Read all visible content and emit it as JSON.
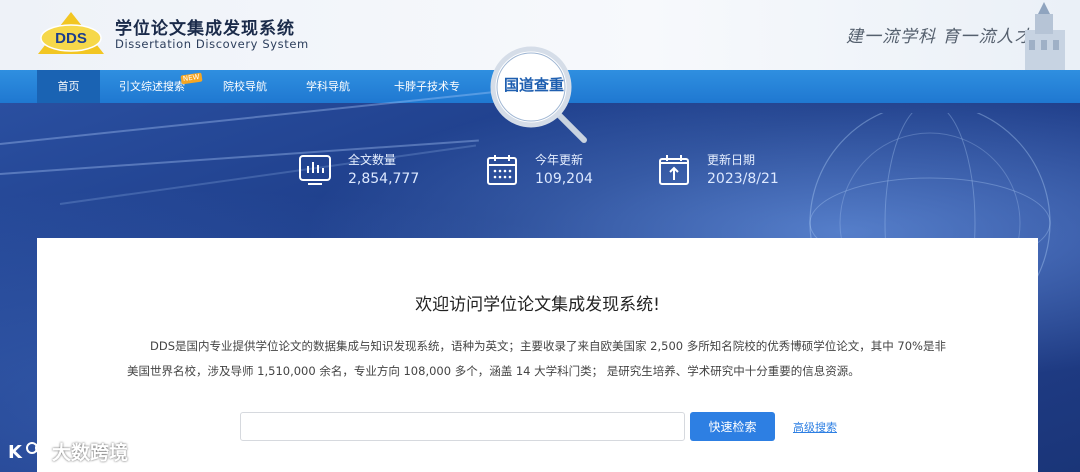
{
  "header": {
    "logo_text": "DDS",
    "title": "学位论文集成发现系统",
    "subtitle": "Dissertation Discovery System",
    "slogan": "建一流学科  育一流人才"
  },
  "nav": {
    "items": [
      {
        "label": "首页",
        "active": true
      },
      {
        "label": "引文综述搜索",
        "badge": "NEW"
      },
      {
        "label": "院校导航"
      },
      {
        "label": "学科导航"
      },
      {
        "label": "卡脖子技术专辑"
      }
    ],
    "feature": "国道查重"
  },
  "stats": [
    {
      "label": "全文数量",
      "value": "2,854,777",
      "icon": "bar-chart-icon"
    },
    {
      "label": "今年更新",
      "value": "109,204",
      "icon": "calendar-icon"
    },
    {
      "label": "更新日期",
      "value": "2023/8/21",
      "icon": "upload-calendar-icon"
    }
  ],
  "main": {
    "welcome": "欢迎访问学位论文集成发现系统!",
    "description": "DDS是国内专业提供学位论文的数据集成与知识发现系统，语种为英文；主要收录了来自欧美国家 2,500 多所知名院校的优秀博硕学位论文，其中 70%是非美国世界名校，涉及导师 1,510,000 余名，专业方向 108,000 多个，涵盖 14 大学科门类； 是研究生培养、学术研究中十分重要的信息资源。"
  },
  "search": {
    "placeholder": "",
    "button_label": "快速检索",
    "advanced_label": "高级搜索"
  },
  "watermark": "大数跨境",
  "colors": {
    "nav_bg": "#2382d6",
    "nav_active": "#1a63b3",
    "accent": "#2d7fe3",
    "banner": "#1f3f8a"
  }
}
